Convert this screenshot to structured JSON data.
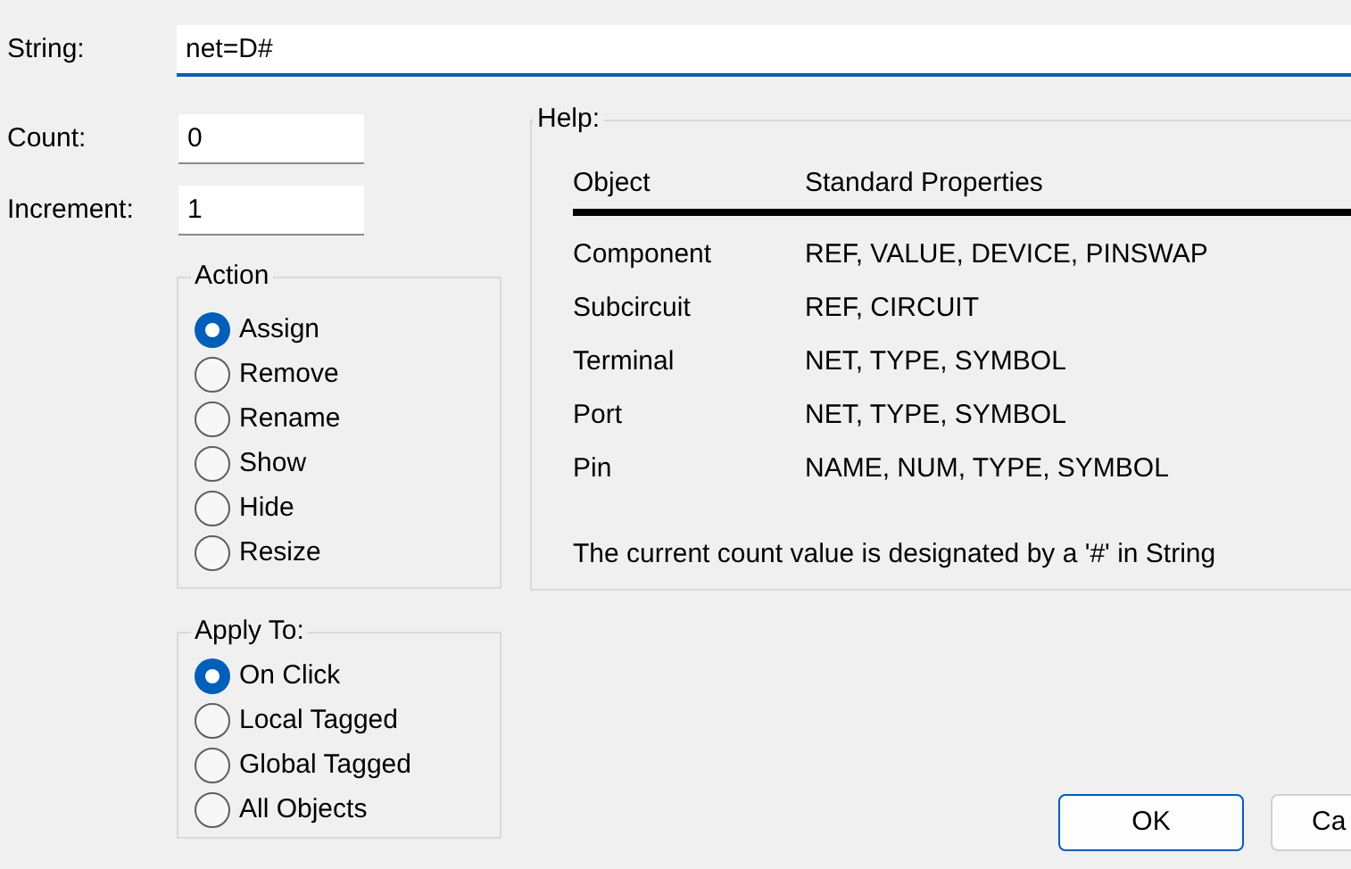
{
  "string": {
    "label": "String:",
    "value": "net=D#"
  },
  "count": {
    "label": "Count:",
    "value": "0"
  },
  "increment": {
    "label": "Increment:",
    "value": "1"
  },
  "action": {
    "title": "Action",
    "options": [
      {
        "label": "Assign",
        "selected": true
      },
      {
        "label": "Remove",
        "selected": false
      },
      {
        "label": "Rename",
        "selected": false
      },
      {
        "label": "Show",
        "selected": false
      },
      {
        "label": "Hide",
        "selected": false
      },
      {
        "label": "Resize",
        "selected": false
      }
    ]
  },
  "apply_to": {
    "title": "Apply To:",
    "options": [
      {
        "label": "On Click",
        "selected": true
      },
      {
        "label": "Local Tagged",
        "selected": false
      },
      {
        "label": "Global Tagged",
        "selected": false
      },
      {
        "label": "All Objects",
        "selected": false
      }
    ]
  },
  "help": {
    "title": "Help:",
    "columns": [
      "Object",
      "Standard Properties"
    ],
    "rows": [
      [
        "Component",
        "REF, VALUE, DEVICE, PINSWAP"
      ],
      [
        "Subcircuit",
        "REF, CIRCUIT"
      ],
      [
        "Terminal",
        "NET, TYPE, SYMBOL"
      ],
      [
        "Port",
        "NET, TYPE, SYMBOL"
      ],
      [
        "Pin",
        "NAME, NUM, TYPE, SYMBOL"
      ]
    ],
    "note": "The current count value is designated by a '#' in String"
  },
  "buttons": [
    "OK",
    "Ca"
  ]
}
